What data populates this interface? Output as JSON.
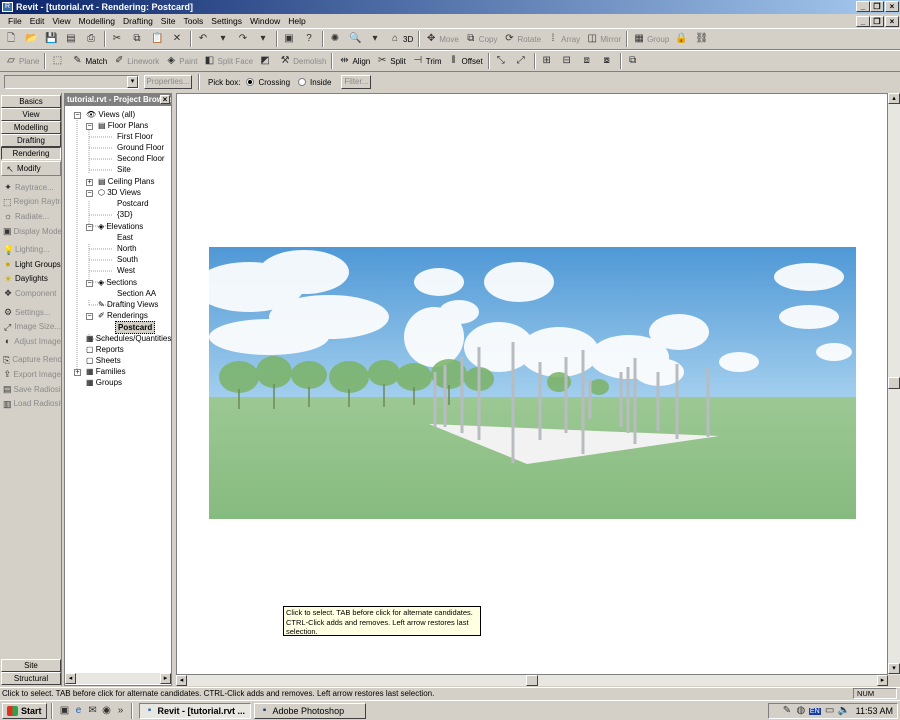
{
  "window": {
    "title": "Revit - [tutorial.rvt - Rendering: Postcard]",
    "app_icon": "revit-logo"
  },
  "menu": [
    "File",
    "Edit",
    "View",
    "Modelling",
    "Drafting",
    "Site",
    "Tools",
    "Settings",
    "Window",
    "Help"
  ],
  "toolbar1": {
    "view_3d_label": "3D",
    "move": "Move",
    "copy": "Copy",
    "rotate": "Rotate",
    "array": "Array",
    "mirror": "Mirror",
    "group": "Group"
  },
  "toolbar2": {
    "plane": "Plane",
    "match": "Match",
    "linework": "Linework",
    "paint": "Paint",
    "split_face": "Split Face",
    "demolish": "Demolish",
    "align": "Align",
    "split": "Split",
    "trim": "Trim",
    "offset": "Offset"
  },
  "options_bar": {
    "properties_label": "Properties...",
    "pick_box_label": "Pick box:",
    "crossing_label": "Crossing",
    "inside_label": "Inside",
    "filter_label": "Filter...",
    "pick_box_selected": "Crossing"
  },
  "design_bar": {
    "tabs": [
      "Basics",
      "View",
      "Modelling",
      "Drafting",
      "Rendering"
    ],
    "modify_label": "Modify",
    "tools": [
      {
        "label": "Raytrace...",
        "enabled": false
      },
      {
        "label": "Region Raytrace",
        "enabled": false
      },
      {
        "label": "Radiate...",
        "enabled": false
      },
      {
        "label": "Display Mode",
        "enabled": false
      },
      {
        "label": "Lighting...",
        "enabled": false
      },
      {
        "label": "Light Groups",
        "enabled": true
      },
      {
        "label": "Daylights",
        "enabled": true
      },
      {
        "label": "Component",
        "enabled": false
      },
      {
        "label": "Settings...",
        "enabled": false
      },
      {
        "label": "Image Size...",
        "enabled": false
      },
      {
        "label": "Adjust Image",
        "enabled": false
      },
      {
        "label": "Capture Rendering",
        "enabled": false
      },
      {
        "label": "Export Image",
        "enabled": false
      },
      {
        "label": "Save Radiosity",
        "enabled": false
      },
      {
        "label": "Load Radiosity",
        "enabled": false
      }
    ],
    "bottom_tabs": [
      "Site",
      "Structural"
    ]
  },
  "project_browser": {
    "title": "tutorial.rvt - Project Browser",
    "tree": {
      "views_all": "Views (all)",
      "floor_plans": "Floor Plans",
      "first_floor": "First Floor",
      "ground_floor": "Ground Floor",
      "second_floor": "Second Floor",
      "site": "Site",
      "ceiling_plans": "Ceiling Plans",
      "views_3d": "3D Views",
      "postcard_3d": "Postcard",
      "view_3d": "{3D}",
      "elevations": "Elevations",
      "east": "East",
      "north": "North",
      "south": "South",
      "west": "West",
      "sections": "Sections",
      "section_aa": "Section AA",
      "drafting_views": "Drafting Views",
      "renderings": "Renderings",
      "postcard_rendering": "Postcard",
      "schedules": "Schedules/Quantities",
      "reports": "Reports",
      "sheets": "Sheets",
      "families": "Families",
      "groups": "Groups"
    }
  },
  "rendering": {
    "sky_color": "#5fa3d8",
    "grass_color": "#8fc08a",
    "slab_color": "#f2f2f2"
  },
  "tooltip": "Click to select. TAB before click for alternate candidates. CTRL-Click adds and removes. Left arrow restores last selection.",
  "status": {
    "message": "Click to select. TAB before click for alternate candidates. CTRL-Click adds and removes. Left arrow restores last selection.",
    "num": "NUM"
  },
  "taskbar": {
    "start": "Start",
    "tasks": [
      "Revit - [tutorial.rvt ...",
      "Adobe Photoshop"
    ],
    "lang": "EN",
    "clock": "11:53 AM"
  }
}
